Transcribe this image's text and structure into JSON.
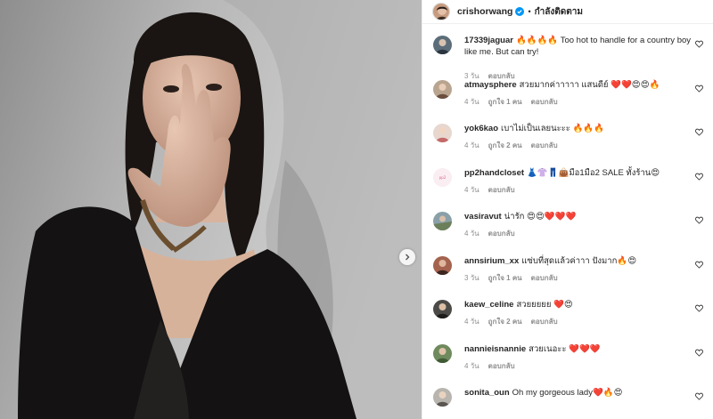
{
  "post": {
    "username": "crishorwang",
    "separator": "•",
    "follow_status": "กำลังติดตาม"
  },
  "colors": {
    "verified": "#0095f6",
    "heart": "#ed4956",
    "text": "#262626",
    "meta": "#8e8e8e"
  },
  "comments": [
    {
      "user": "17339jaguar",
      "text": "🔥🔥🔥🔥 Too hot to handle for a country boy like me. But can try!",
      "time": "3 วัน",
      "likes": "",
      "reply": "ตอบกลับ"
    },
    {
      "user": "atmaysphere",
      "text": "สวยมากค่าาาาา แสนดีย์ ❤️❤️😍😍🔥",
      "time": "4 วัน",
      "likes": "ถูกใจ 1 คน",
      "reply": "ตอบกลับ"
    },
    {
      "user": "yok6kao",
      "text": "เบาไม่เป็นเลยนะะะ 🔥🔥🔥",
      "time": "4 วัน",
      "likes": "ถูกใจ 2 คน",
      "reply": "ตอบกลับ"
    },
    {
      "user": "pp2handcloset",
      "text": "👗👚👖👜มือ1มือ2 SALE ทั้งร้าน😍",
      "time": "4 วัน",
      "likes": "",
      "reply": "ตอบกลับ"
    },
    {
      "user": "vasiravut",
      "text": "น่ารัก 😍😍❤️❤️❤️",
      "time": "4 วัน",
      "likes": "",
      "reply": "ตอบกลับ"
    },
    {
      "user": "annsirium_xx",
      "text": "แซ่บที่สุดแล้วค่าาา ปังมาก🔥😍",
      "time": "3 วัน",
      "likes": "ถูกใจ 1 คน",
      "reply": "ตอบกลับ"
    },
    {
      "user": "kaew_celine",
      "text": "สวยยยยย ❤️😍",
      "time": "4 วัน",
      "likes": "ถูกใจ 2 คน",
      "reply": "ตอบกลับ"
    },
    {
      "user": "nannieisnannie",
      "text": "สวยเนอะะ ❤️❤️❤️",
      "time": "4 วัน",
      "likes": "",
      "reply": "ตอบกลับ"
    },
    {
      "user": "sonita_oun",
      "text": "Oh my gorgeous lady❤️🔥😍",
      "time": "",
      "likes": "",
      "reply": ""
    }
  ]
}
